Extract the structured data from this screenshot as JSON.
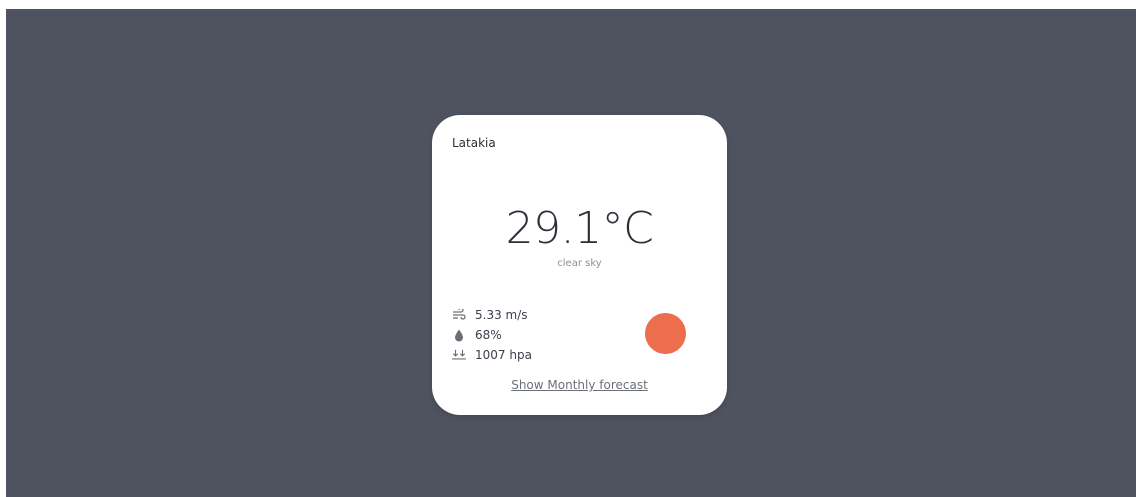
{
  "weather_card": {
    "city": "Latakia",
    "temperature": "29.1°C",
    "description": "clear sky",
    "wind": "5.33 m/s",
    "humidity": "68%",
    "pressure": "1007 hpa",
    "forecast_link": "Show Monthly forecast"
  },
  "icons": {
    "wind": "wind-icon",
    "humidity": "droplet-icon",
    "pressure": "pressure-icon",
    "condition": "sun-icon"
  },
  "colors": {
    "background": "#4f5360",
    "card": "#ffffff",
    "sun": "#ec6e4c"
  }
}
